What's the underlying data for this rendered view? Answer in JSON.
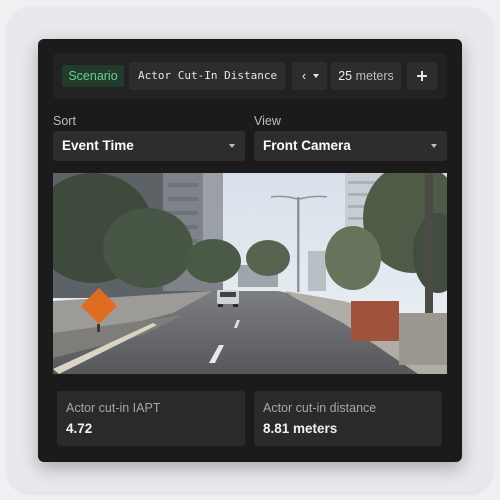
{
  "toolbar": {
    "scenario_label": "Scenario",
    "scenario_value": "Actor Cut-In Distance",
    "prev_glyph": "‹",
    "distance_value": "25",
    "distance_unit": "meters"
  },
  "controls": {
    "sort_label": "Sort",
    "sort_value": "Event Time",
    "view_label": "View",
    "view_value": "Front Camera"
  },
  "camera": {
    "scene": "street-camera-frame"
  },
  "metrics": [
    {
      "label": "Actor cut-in IAPT",
      "value": "4.72"
    },
    {
      "label": "Actor cut-in distance",
      "value": "8.81 meters"
    }
  ],
  "colors": {
    "page_bg": "#eef0f2",
    "panel_bg": "#1b1b1b",
    "control_bg": "#2d2d2d",
    "badge_bg": "#213c2d",
    "badge_text": "#6ecb94",
    "card_bg": "#2a2a2a"
  }
}
